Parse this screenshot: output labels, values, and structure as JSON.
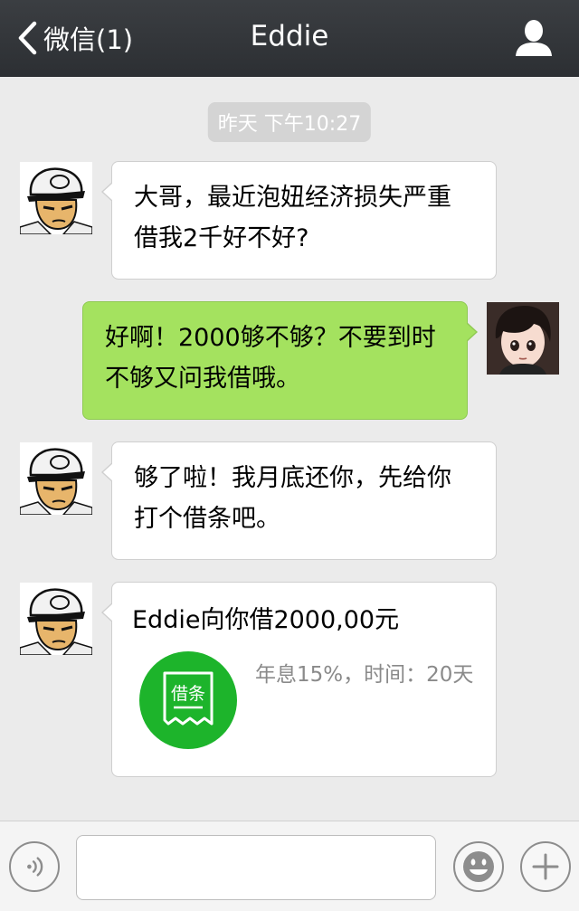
{
  "header": {
    "back_label": "微信(1)",
    "title": "Eddie",
    "contact_icon": "person-icon"
  },
  "timestamp": "昨天 下午10:27",
  "messages": [
    {
      "side": "left",
      "lines": [
        "大哥，最近泡妞经济损失严重",
        "借我2千好不好?"
      ]
    },
    {
      "side": "right",
      "lines": [
        "好啊！2000够不够？不要到时",
        "不够又问我借哦。"
      ]
    },
    {
      "side": "left",
      "lines": [
        "够了啦！我月底还你，先给你",
        "打个借条吧。"
      ]
    },
    {
      "side": "left",
      "type": "iou-card",
      "title": "Eddie向你借2000,00元",
      "icon_label": "借条",
      "detail": "年息15%，时间：20天"
    }
  ],
  "input": {
    "value": "",
    "placeholder": ""
  },
  "colors": {
    "header_bg": "#2c2f33",
    "chat_bg": "#ebebeb",
    "sent_bubble": "#a4e25f",
    "received_bubble": "#ffffff",
    "iou_green": "#1db42b"
  },
  "icons": {
    "voice": "voice-icon",
    "emoji": "emoji-icon",
    "plus": "plus-icon",
    "back": "chevron-left-icon"
  }
}
